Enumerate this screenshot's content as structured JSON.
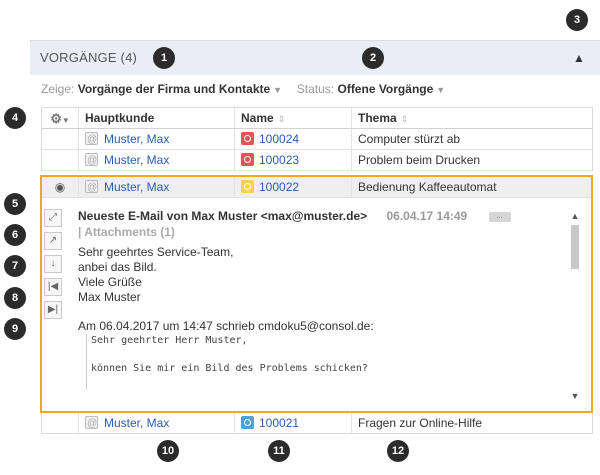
{
  "panel": {
    "title": "VORGÄNGE (4)",
    "collapse_icon": "chevron-up-icon"
  },
  "filter": {
    "show_label": "Zeige:",
    "show_value": "Vorgänge der Firma und Kontakte",
    "status_label": "Status:",
    "status_value": "Offene Vorgänge"
  },
  "table": {
    "columns": [
      "Hauptkunde",
      "Name",
      "Thema"
    ],
    "rows": [
      {
        "customer": "Muster, Max",
        "name": "100024",
        "topic": "Computer stürzt ab",
        "ticket_color": "#e05555"
      },
      {
        "customer": "Muster, Max",
        "name": "100023",
        "topic": "Problem beim Drucken",
        "ticket_color": "#e05555"
      },
      {
        "customer": "Muster, Max",
        "name": "100022",
        "topic": "Bedienung Kaffeeautomat",
        "ticket_color": "#f4d34d"
      }
    ],
    "last_row": {
      "customer": "Muster, Max",
      "name": "100021",
      "topic": "Fragen zur Online-Hilfe",
      "ticket_color": "#4aa3df"
    }
  },
  "preview": {
    "heading": "Neueste E-Mail von Max Muster <max@muster.de>",
    "date": "06.04.17 14:49",
    "more_label": "...",
    "attachments": "|  Attachments (1)",
    "body": [
      "Sehr geehrtes Service-Team,",
      "anbei das Bild.",
      "Viele Grüße",
      "Max Muster"
    ],
    "quote_intro": "Am 06.04.2017 um 14:47 schrieb cmdoku5@consol.de:",
    "quote_lines": [
      "Sehr geehrter Herr Muster,",
      "",
      "können Sie mir ein Bild des Problems schicken?"
    ]
  },
  "markers": [
    "1",
    "2",
    "3",
    "4",
    "5",
    "6",
    "7",
    "8",
    "9",
    "10",
    "11",
    "12"
  ]
}
